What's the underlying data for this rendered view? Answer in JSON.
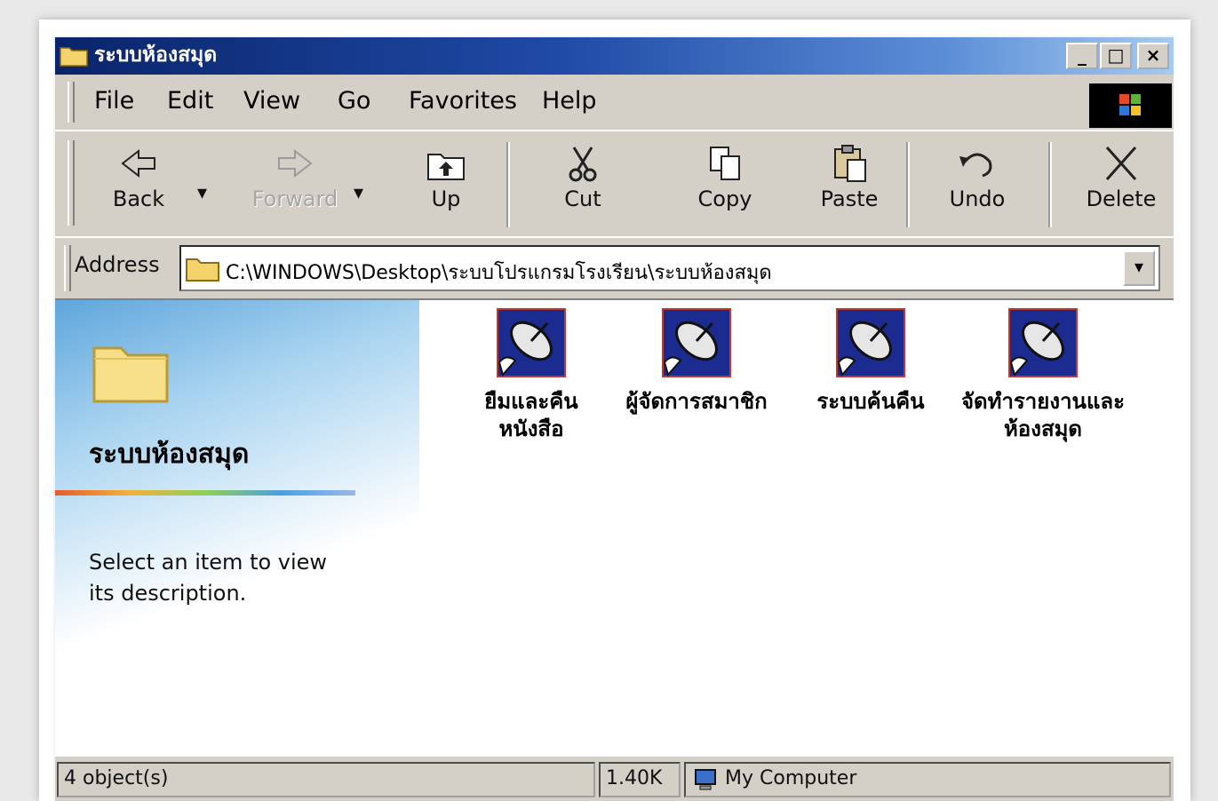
{
  "window": {
    "title": "ระบบห้องสมุด",
    "minimize_label": "_",
    "maximize_label": "□",
    "close_label": "×"
  },
  "menu": {
    "items": [
      "File",
      "Edit",
      "View",
      "Go",
      "Favorites",
      "Help"
    ]
  },
  "toolbar": {
    "back_label": "Back",
    "forward_label": "Forward",
    "up_label": "Up",
    "cut_label": "Cut",
    "copy_label": "Copy",
    "paste_label": "Paste",
    "undo_label": "Undo",
    "delete_label": "Delete",
    "dropdown_glyph": "▾"
  },
  "address": {
    "label": "Address",
    "path": "C:\\WINDOWS\\Desktop\\ระบบโปรแกรมโรงเรียน\\ระบบห้องสมุด",
    "dropdown_glyph": "▾"
  },
  "sidebar": {
    "folder_name": "ระบบห้องสมุด",
    "description": "Select an item to view its description."
  },
  "files": [
    {
      "name": "ยืมและคืน\nหนังสือ",
      "icon": "satellite-dish-shortcut-icon"
    },
    {
      "name": "ผู้จัดการสมาชิก",
      "icon": "satellite-dish-shortcut-icon"
    },
    {
      "name": "ระบบค้นคืน",
      "icon": "satellite-dish-shortcut-icon"
    },
    {
      "name": "จัดทำรายงานและ\nห้องสมุด",
      "icon": "satellite-dish-shortcut-icon"
    }
  ],
  "status": {
    "left": "4 object(s)",
    "size": "1.40K",
    "location": "My Computer"
  },
  "colors": {
    "titlebar_start": "#0a246a",
    "titlebar_end": "#a6caf0",
    "chrome": "#d4d0c8",
    "icon_bg": "#1b2b8f"
  }
}
